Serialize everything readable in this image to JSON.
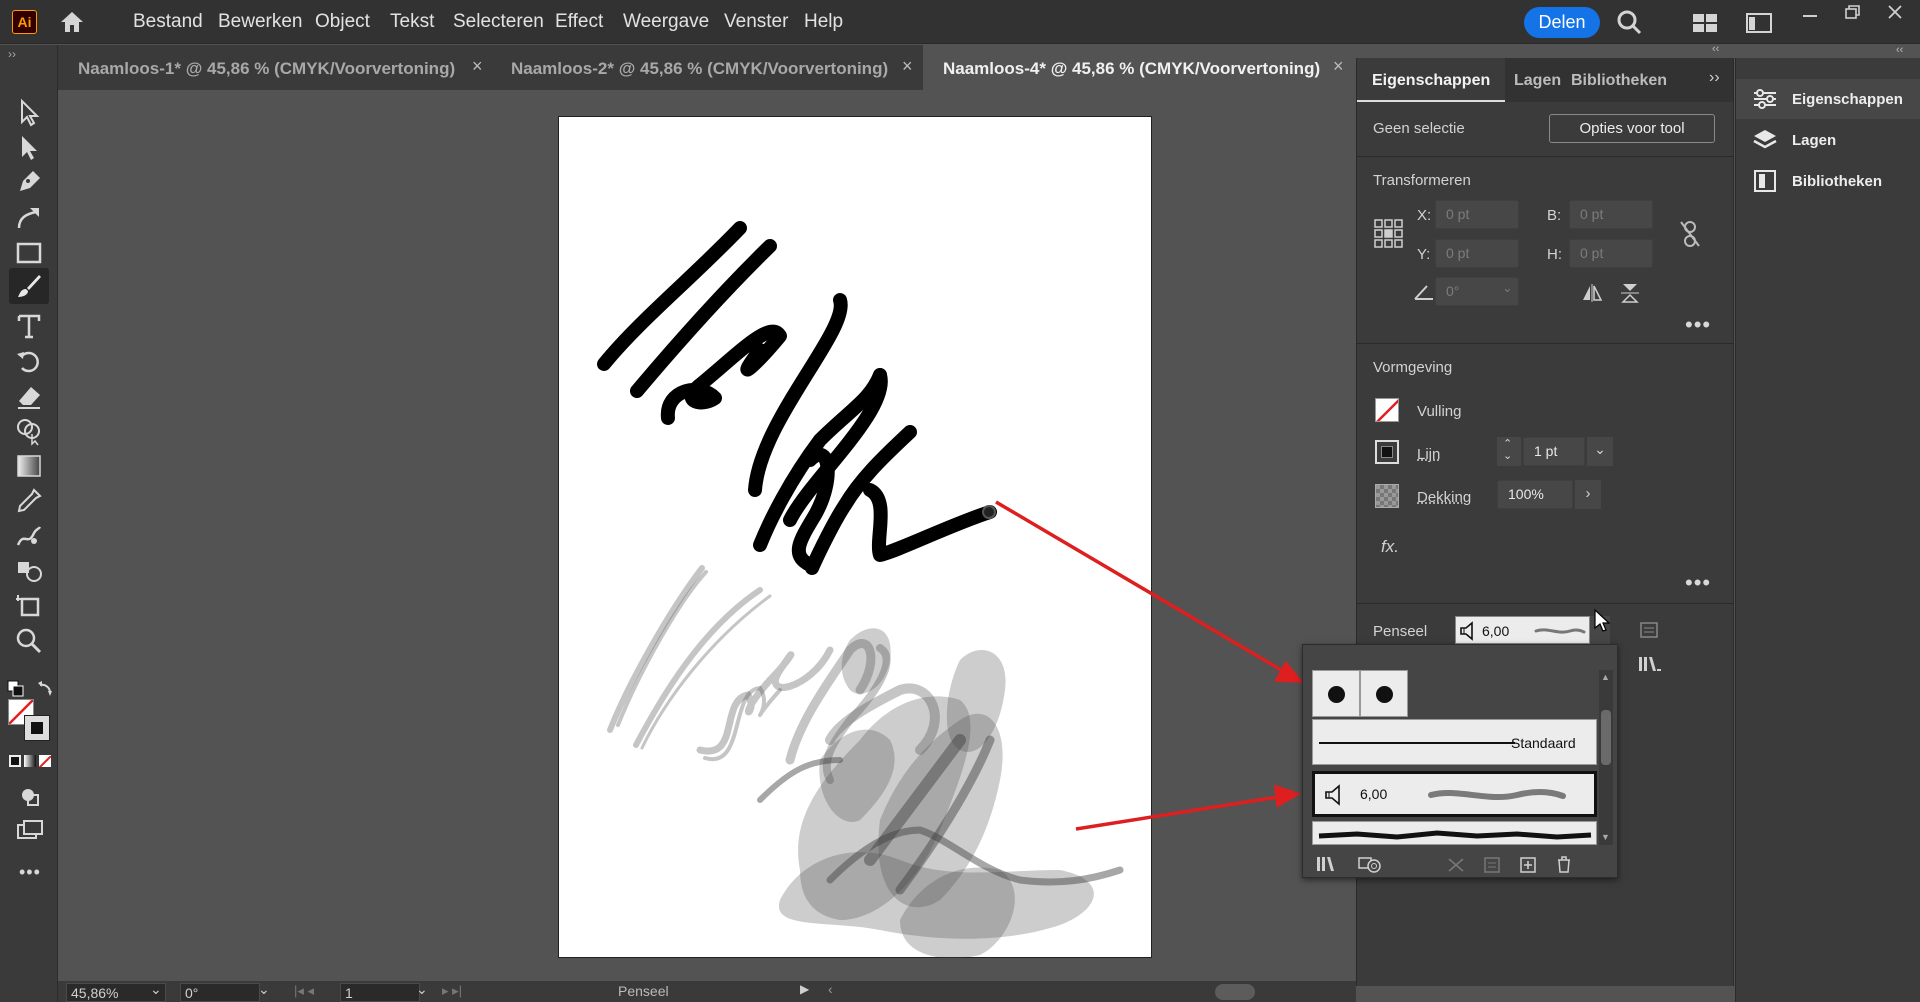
{
  "app": {
    "logo": "Ai"
  },
  "menu": [
    "Bestand",
    "Bewerken",
    "Object",
    "Tekst",
    "Selecteren",
    "Effect",
    "Weergave",
    "Venster",
    "Help"
  ],
  "share_label": "Delen",
  "tabs": [
    {
      "title": "Naamloos-1* @ 45,86 % (CMYK/Voorvertoning)",
      "close": "×"
    },
    {
      "title": "Naamloos-2* @ 45,86 % (CMYK/Voorvertoning)",
      "close": "×"
    },
    {
      "title": "Naamloos-4* @ 45,86 % (CMYK/Voorvertoning)",
      "close": "×"
    }
  ],
  "tools": [
    "selection-tool-icon",
    "direct-selection-tool-icon",
    "pen-tool-icon",
    "curvature-tool-icon",
    "rectangle-tool-icon",
    "paintbrush-tool-icon",
    "type-tool-icon",
    "rotate-tool-icon",
    "eraser-tool-icon",
    "shape-builder-tool-icon",
    "gradient-tool-icon",
    "eyedropper-tool-icon",
    "puppet-warp-tool-icon",
    "symbol-sprayer-tool-icon",
    "artboard-tool-icon",
    "zoom-tool-icon"
  ],
  "toolbar": {
    "more": "•••"
  },
  "panel": {
    "tabs": [
      "Eigenschappen",
      "Lagen",
      "Bibliotheken"
    ],
    "no_selection": "Geen selectie",
    "tool_options": "Opties voor tool",
    "transform_title": "Transformeren",
    "x_label": "X:",
    "x_value": "0 pt",
    "y_label": "Y:",
    "y_value": "0 pt",
    "b_label": "B:",
    "b_value": "0 pt",
    "h_label": "H:",
    "h_value": "0 pt",
    "angle_value": "0°",
    "appearance_title": "Vormgeving",
    "fill_label": "Vulling",
    "stroke_label": "Lijn",
    "stroke_value": "1 pt",
    "opacity_label": "Dekking",
    "opacity_value": "100%",
    "fx_label": "fx.",
    "more": "•••",
    "brush_label": "Penseel",
    "brush_value": "6,00"
  },
  "right_column": [
    "Eigenschappen",
    "Lagen",
    "Bibliotheken"
  ],
  "brush_popup": {
    "standard_label": "Standaard",
    "selected_size": "6,00"
  },
  "status": {
    "zoom": "45,86%",
    "rotation": "0°",
    "artboard": "1",
    "tool": "Penseel"
  },
  "colors": {
    "accent": "#1473e6",
    "arrow": "#e02020",
    "logo": "#ff9a00"
  }
}
